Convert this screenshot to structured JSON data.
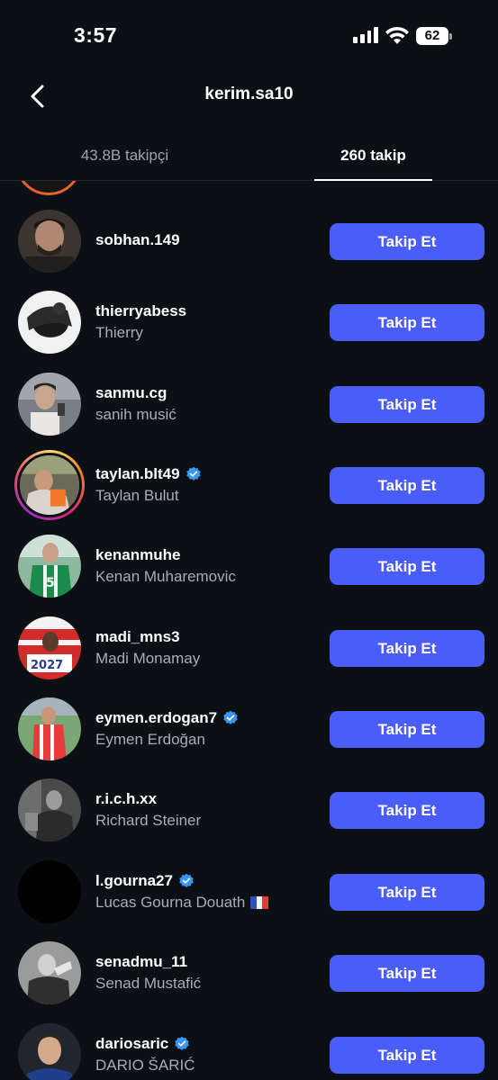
{
  "status_bar": {
    "time": "3:57",
    "battery": "62",
    "icons": [
      "signal-icon",
      "wifi-icon",
      "battery-icon"
    ]
  },
  "header": {
    "title": "kerim.sa10",
    "back_icon": "chevron-left-icon"
  },
  "tabs": [
    {
      "label": "43.8B takipçi",
      "active": false
    },
    {
      "label": "260 takip",
      "active": true
    }
  ],
  "colors": {
    "background": "#0c0f14",
    "button": "#4a5df9",
    "muted_text": "#a8adb3",
    "verified": "#3897f0"
  },
  "follow_button_label": "Takip Et",
  "users": [
    {
      "username": "sobhan.149",
      "full_name": "",
      "verified": false,
      "story_ring": false
    },
    {
      "username": "thierryabess",
      "full_name": "Thierry",
      "verified": false,
      "story_ring": false
    },
    {
      "username": "sanmu.cg",
      "full_name": "sanih musić",
      "verified": false,
      "story_ring": false
    },
    {
      "username": "taylan.blt49",
      "full_name": "Taylan Bulut",
      "verified": true,
      "story_ring": true
    },
    {
      "username": "kenanmuhe",
      "full_name": "Kenan Muharemovic",
      "verified": false,
      "story_ring": false
    },
    {
      "username": "madi_mns3",
      "full_name": "Madi Monamay",
      "verified": false,
      "story_ring": false
    },
    {
      "username": "eymen.erdogan7",
      "full_name": "Eymen Erdoğan",
      "verified": true,
      "story_ring": false
    },
    {
      "username": "r.i.c.h.xx",
      "full_name": "Richard Steiner",
      "verified": false,
      "story_ring": false
    },
    {
      "username": "l.gourna27",
      "full_name": "Lucas Gourna Douath",
      "verified": true,
      "story_ring": false,
      "flag": "french-flag-icon"
    },
    {
      "username": "senadmu_11",
      "full_name": "Senad Mustafić",
      "verified": false,
      "story_ring": false
    },
    {
      "username": "dariosaric",
      "full_name": "DARIO ŠARIĆ",
      "verified": true,
      "story_ring": false
    }
  ]
}
